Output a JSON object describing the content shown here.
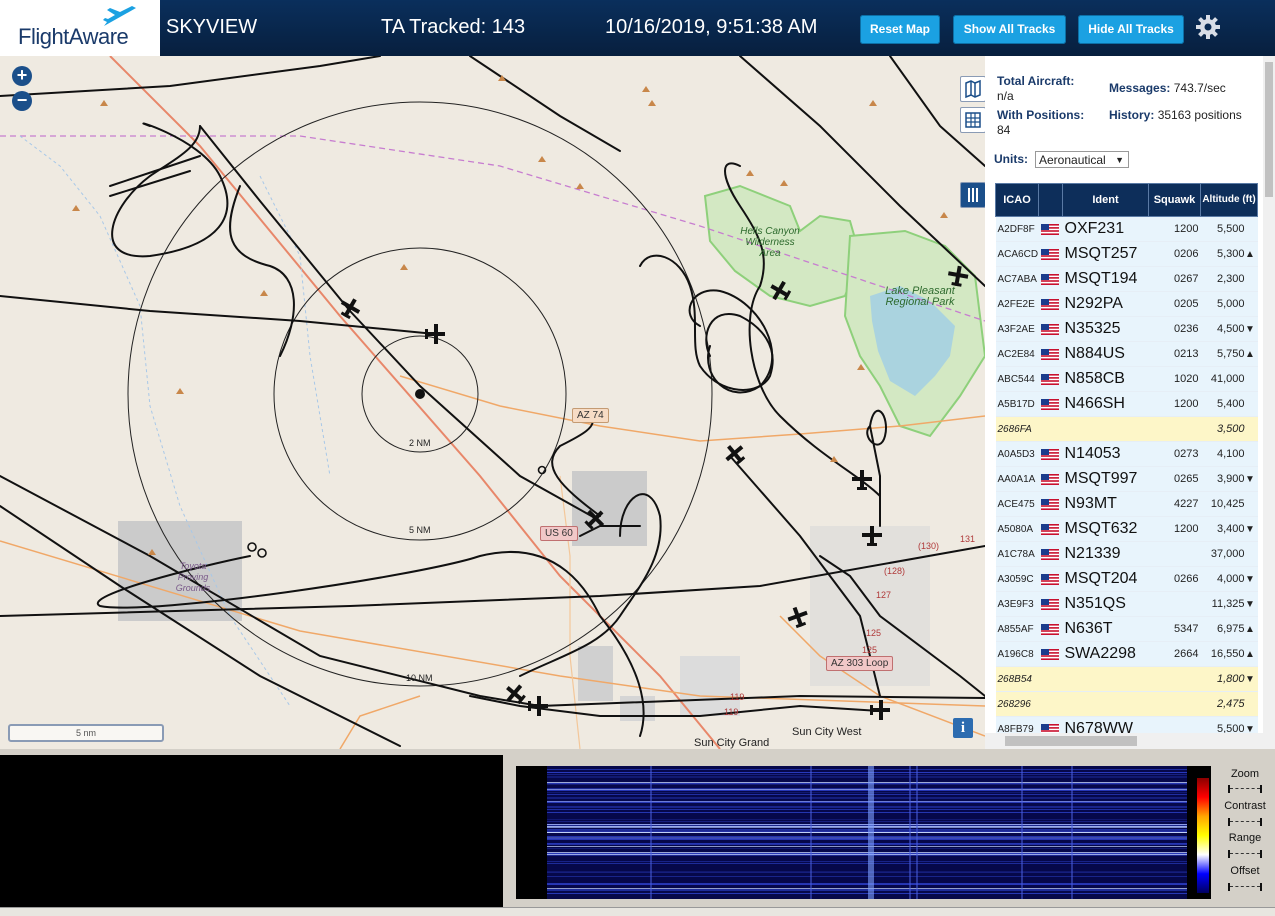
{
  "header": {
    "logo_text": "FlightAware",
    "app_title": "SKYVIEW",
    "tracked_label": "TA Tracked: 143",
    "datetime": "10/16/2019, 9:51:38 AM",
    "buttons": {
      "reset_map": "Reset Map",
      "show_all_tracks": "Show All Tracks",
      "hide_all_tracks": "Hide All Tracks"
    },
    "settings_icon": "gear-icon"
  },
  "map": {
    "zoom_in": "+",
    "zoom_out": "−",
    "rings": [
      "2 NM",
      "5 NM",
      "10 NM"
    ],
    "places": {
      "hells_canyon": "Hells Canyon Wilderness Area",
      "lake_pleasant": "Lake Pleasant Regional Park",
      "proving_grounds": "Toyota Proving Grounds",
      "sun_city_grand": "Sun City Grand",
      "sun_city_west": "Sun City West"
    },
    "road_signs": [
      "AZ 74",
      "US 60",
      "AZ 303 Loop"
    ],
    "road_numbers": [
      "(130)",
      "131",
      "(128)",
      "127",
      "125",
      "125",
      "119",
      "119"
    ],
    "scale_bar": "5 nm",
    "info_button": "i",
    "colors": {
      "track": "#111111",
      "aircraft": "#111111",
      "ring": "#222222",
      "road_orange": "#f0a868",
      "road_red": "#e8876a",
      "boundary_green": "#8ed07b",
      "border_purple": "#c77dd0",
      "water": "#aad3df"
    }
  },
  "sidebar": {
    "total_aircraft_label": "Total Aircraft:",
    "total_aircraft_value": "n/a",
    "with_positions_label": "With Positions:",
    "with_positions_value": "84",
    "messages_label": "Messages:",
    "messages_value": "743.7/sec",
    "history_label": "History:",
    "history_value": "35163 positions",
    "units_label": "Units:",
    "units_value": "Aeronautical",
    "table_headers": {
      "icao": "ICAO",
      "ident": "Ident",
      "squawk": "Squawk",
      "altitude": "Altitude (ft)"
    },
    "rows": [
      {
        "icao": "A2DF8F",
        "flag": true,
        "ident": "OXF231",
        "squawk": "1200",
        "altitude": "5,500",
        "trend": "",
        "highlight": false
      },
      {
        "icao": "ACA6CD",
        "flag": true,
        "ident": "MSQT257",
        "squawk": "0206",
        "altitude": "5,300",
        "trend": "▲",
        "highlight": false
      },
      {
        "icao": "AC7ABA",
        "flag": true,
        "ident": "MSQT194",
        "squawk": "0267",
        "altitude": "2,300",
        "trend": "",
        "highlight": false
      },
      {
        "icao": "A2FE2E",
        "flag": true,
        "ident": "N292PA",
        "squawk": "0205",
        "altitude": "5,000",
        "trend": "",
        "highlight": false
      },
      {
        "icao": "A3F2AE",
        "flag": true,
        "ident": "N35325",
        "squawk": "0236",
        "altitude": "4,500",
        "trend": "▼",
        "highlight": false
      },
      {
        "icao": "AC2E84",
        "flag": true,
        "ident": "N884US",
        "squawk": "0213",
        "altitude": "5,750",
        "trend": "▲",
        "highlight": false
      },
      {
        "icao": "ABC544",
        "flag": true,
        "ident": "N858CB",
        "squawk": "1020",
        "altitude": "41,000",
        "trend": "",
        "highlight": false
      },
      {
        "icao": "A5B17D",
        "flag": true,
        "ident": "N466SH",
        "squawk": "1200",
        "altitude": "5,400",
        "trend": "",
        "highlight": false
      },
      {
        "icao": "2686FA",
        "flag": false,
        "ident": "",
        "squawk": "",
        "altitude": "3,500",
        "trend": "",
        "highlight": true
      },
      {
        "icao": "A0A5D3",
        "flag": true,
        "ident": "N14053",
        "squawk": "0273",
        "altitude": "4,100",
        "trend": "",
        "highlight": false
      },
      {
        "icao": "AA0A1A",
        "flag": true,
        "ident": "MSQT997",
        "squawk": "0265",
        "altitude": "3,900",
        "trend": "▼",
        "highlight": false
      },
      {
        "icao": "ACE475",
        "flag": true,
        "ident": "N93MT",
        "squawk": "4227",
        "altitude": "10,425",
        "trend": "",
        "highlight": false
      },
      {
        "icao": "A5080A",
        "flag": true,
        "ident": "MSQT632",
        "squawk": "1200",
        "altitude": "3,400",
        "trend": "▼",
        "highlight": false
      },
      {
        "icao": "A1C78A",
        "flag": true,
        "ident": "N21339",
        "squawk": "",
        "altitude": "37,000",
        "trend": "",
        "highlight": false
      },
      {
        "icao": "A3059C",
        "flag": true,
        "ident": "MSQT204",
        "squawk": "0266",
        "altitude": "4,000",
        "trend": "▼",
        "highlight": false
      },
      {
        "icao": "A3E9F3",
        "flag": true,
        "ident": "N351QS",
        "squawk": "",
        "altitude": "11,325",
        "trend": "▼",
        "highlight": false
      },
      {
        "icao": "A855AF",
        "flag": true,
        "ident": "N636T",
        "squawk": "5347",
        "altitude": "6,975",
        "trend": "▲",
        "highlight": false
      },
      {
        "icao": "A196C8",
        "flag": true,
        "ident": "SWA2298",
        "squawk": "2664",
        "altitude": "16,550",
        "trend": "▲",
        "highlight": false
      },
      {
        "icao": "268B54",
        "flag": false,
        "ident": "",
        "squawk": "",
        "altitude": "1,800",
        "trend": "▼",
        "highlight": true
      },
      {
        "icao": "268296",
        "flag": false,
        "ident": "",
        "squawk": "",
        "altitude": "2,475",
        "trend": "",
        "highlight": true
      },
      {
        "icao": "A8FB79",
        "flag": true,
        "ident": "N678WW",
        "squawk": "",
        "altitude": "5,500",
        "trend": "▼",
        "highlight": false
      }
    ]
  },
  "spectrum": {
    "controls": [
      "Zoom",
      "Contrast",
      "Range",
      "Offset"
    ]
  }
}
